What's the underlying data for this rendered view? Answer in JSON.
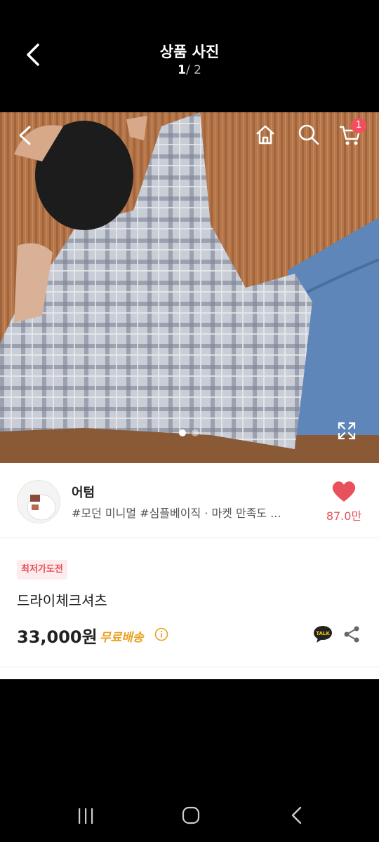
{
  "header": {
    "title": "상품 사진",
    "pager_current": "1",
    "pager_rest": "/ 2"
  },
  "photo": {
    "cart_count": "1",
    "indicator_active": 0,
    "indicator_count": 2
  },
  "store": {
    "name": "어텀",
    "tags": "#모던 미니멀 #심플베이직 · 마켓 만족도 ...",
    "likes": "87.0만"
  },
  "product": {
    "badge": "최저가도전",
    "name": "드라이체크셔츠",
    "price": "33,000원",
    "shipping": "무료배송",
    "talk_label": "TALK"
  },
  "colors": {
    "accent_pink": "#e8505b",
    "shipping_orange": "#e8a020",
    "badge_bg": "#fdecee"
  }
}
